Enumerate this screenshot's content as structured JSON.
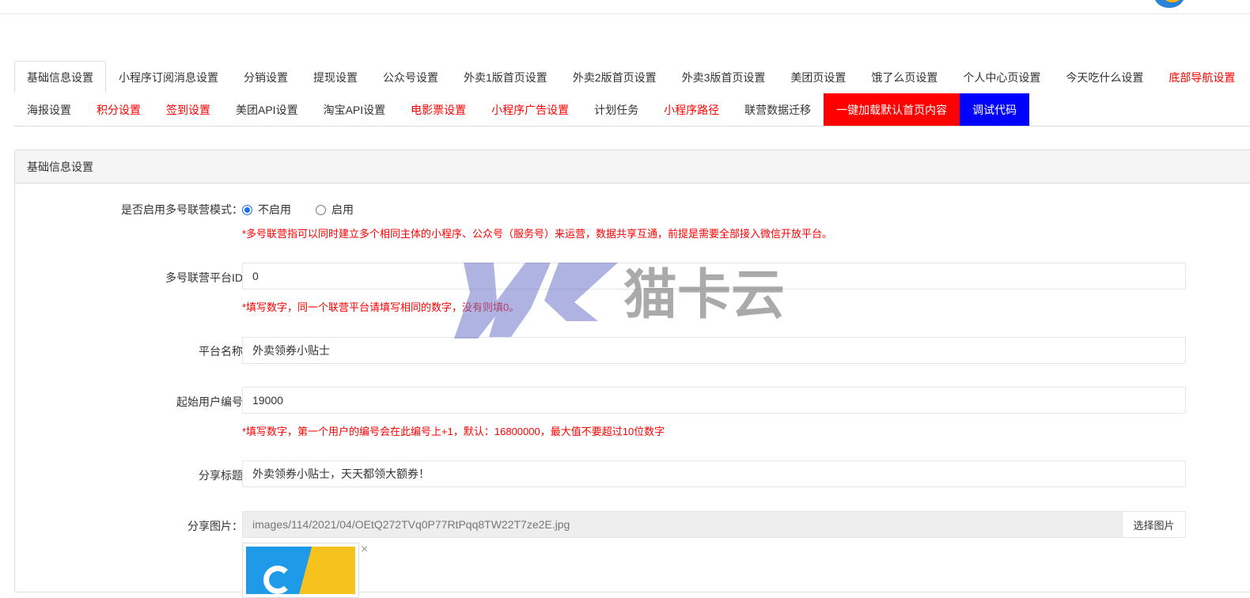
{
  "tabs_row1": [
    {
      "label": "基础信息设置",
      "active": true
    },
    {
      "label": "小程序订阅消息设置"
    },
    {
      "label": "分销设置"
    },
    {
      "label": "提现设置"
    },
    {
      "label": "公众号设置"
    },
    {
      "label": "外卖1版首页设置"
    },
    {
      "label": "外卖2版首页设置"
    },
    {
      "label": "外卖3版首页设置"
    },
    {
      "label": "美团页设置"
    },
    {
      "label": "饿了么页设置"
    },
    {
      "label": "个人中心页设置"
    },
    {
      "label": "今天吃什么设置"
    },
    {
      "label": "底部导航设置",
      "color": "red"
    }
  ],
  "tabs_row2": [
    {
      "label": "海报设置"
    },
    {
      "label": "积分设置",
      "color": "red"
    },
    {
      "label": "签到设置",
      "color": "red"
    },
    {
      "label": "美团API设置"
    },
    {
      "label": "淘宝API设置"
    },
    {
      "label": "电影票设置",
      "color": "red"
    },
    {
      "label": "小程序广告设置",
      "color": "red"
    },
    {
      "label": "计划任务"
    },
    {
      "label": "小程序路径",
      "color": "red"
    },
    {
      "label": "联营数据迁移"
    },
    {
      "label": "一键加载默认首页内容",
      "style": "btn-red"
    },
    {
      "label": "调试代码",
      "style": "btn-blue"
    }
  ],
  "panel": {
    "heading": "基础信息设置",
    "multi_mode": {
      "label": "是否启用多号联营模式：",
      "options": [
        "不启用",
        "启用"
      ],
      "selected": "不启用",
      "help": "*多号联营指可以同时建立多个相同主体的小程序、公众号（服务号）来运营，数据共享互通，前提是需要全部接入微信开放平台。"
    },
    "platform_id": {
      "label": "多号联营平台ID",
      "value": "0",
      "help": "*填写数字，同一个联营平台请填写相同的数字，没有则填0。"
    },
    "platform_name": {
      "label": "平台名称",
      "value": "外卖领券小贴士"
    },
    "start_user_no": {
      "label": "起始用户编号",
      "value": "19000",
      "help": "*填写数字，第一个用户的编号会在此编号上+1，默认：16800000，最大值不要超过10位数字"
    },
    "share_title": {
      "label": "分享标题",
      "value": "外卖领券小贴士，天天都领大额券！"
    },
    "share_image": {
      "label": "分享图片：",
      "value": "images/114/2021/04/OEtQ272TVq0P77RtPqq8TW22T7ze2E.jpg",
      "button": "选择图片",
      "remove": "×"
    }
  },
  "watermark": {
    "brand": "猫卡云",
    "logo_text": "MK"
  },
  "colors": {
    "red": "#ff0000",
    "blue": "#0000ff",
    "radio": "#1a73e8"
  }
}
